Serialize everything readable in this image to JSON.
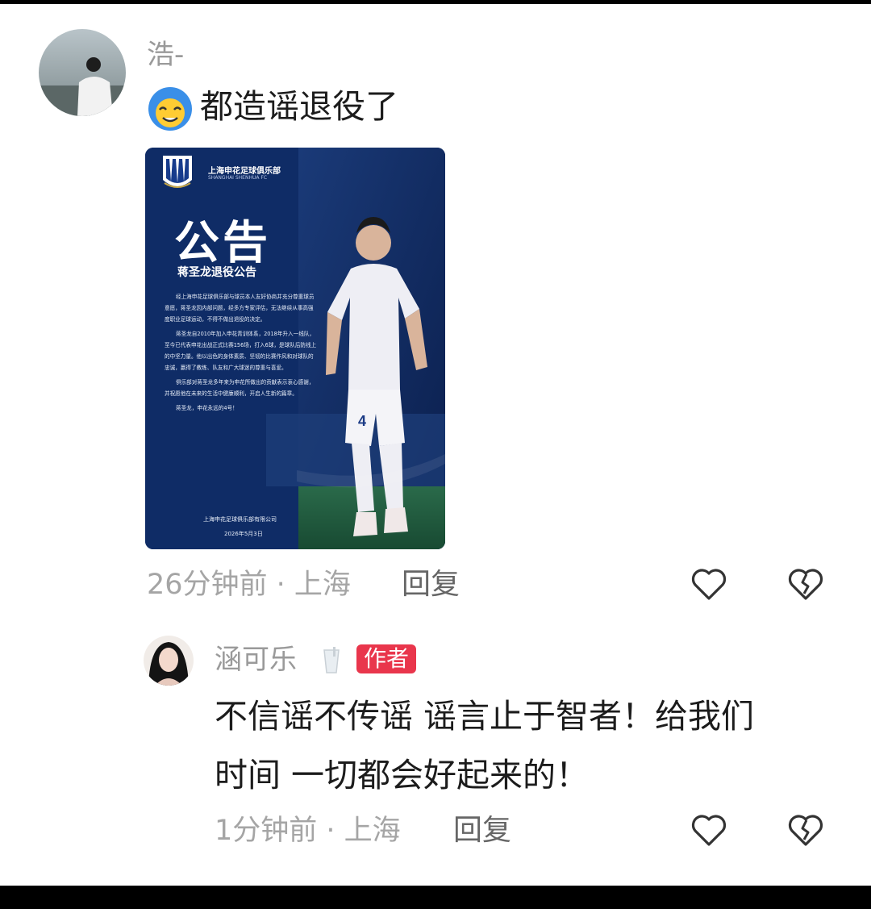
{
  "comments": [
    {
      "username": "浩-",
      "emoji": "😵",
      "text": "都造谣退役了",
      "time_location": "26分钟前 · 上海",
      "reply_label": "回复",
      "attachment": {
        "club_name": "上海申花足球俱乐部",
        "club_name_en": "SHANGHAI SHENHUA FC",
        "title": "公告",
        "subtitle": "蒋圣龙退役公告",
        "paragraphs": [
          "经上海申花足球俱乐部与球员本人友好协商并充分尊重球员意愿，蒋圣龙因内部问题，经多方专家评估，无法继续从事高强度职业足球运动，不得不做出退役的决定。",
          "蒋圣龙自2010年加入申花青训体系，2018年升入一线队，至今已代表申花出战正式比赛156场，打入6球，是球队后防线上的中坚力量。他以出色的身体素质、坚韧的比赛作风和对球队的忠诚，赢得了教练、队友和广大球迷的尊重与喜爱。",
          "俱乐部对蒋圣龙多年来为申花所做出的贡献表示衷心感谢，并祝愿他在未来的生活中健康顺利，开启人生新的篇章。",
          "蒋圣龙，申花永远的4号！"
        ],
        "signature": "上海申花足球俱乐部有限公司",
        "date": "2026年5月3日",
        "jersey_number": "4"
      }
    },
    {
      "username": "涵可乐",
      "badge": "作者",
      "text_line1": "不信谣不传谣 谣言止于智者！给我们",
      "text_line2": "时间 一切都会好起来的！",
      "time_location": "1分钟前 · 上海",
      "reply_label": "回复"
    }
  ],
  "icons": [
    "like-heart-icon",
    "dislike-broken-heart-icon"
  ],
  "colors": {
    "badge": "#e9364c",
    "poster_bg": "#0f2c66",
    "meta_gray": "#a5a5a5"
  }
}
